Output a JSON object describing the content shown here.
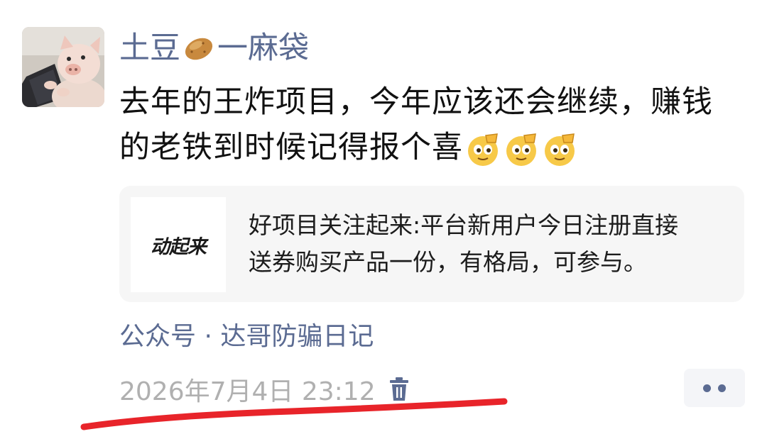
{
  "author": {
    "name_before_icon": "土豆",
    "name_icon": "potato-icon",
    "name_after_icon": "一麻袋"
  },
  "post": {
    "text_line1": "去年的王炸项目，今年应该还会继续，赚钱",
    "text_line2": "的老铁到时候记得报个喜",
    "trailing_emoji": "salute-face-emoji",
    "trailing_emoji_count": 3
  },
  "share_card": {
    "thumbnail_text": "动起来",
    "title_line1": "好项目关注起来:平台新用户今日注册直接",
    "title_line2": "送券购买产品一份，有格局，可参与。"
  },
  "source": {
    "text": "公众号 · 达哥防骗日记"
  },
  "meta": {
    "timestamp": "2026年7月4日 23:12",
    "delete_icon": "trash-icon",
    "more_icon": "more-dots-icon"
  },
  "colors": {
    "link_blue": "#5b6b92",
    "timestamp_gray": "#b0b0b0",
    "card_bg": "#f6f6f6",
    "annotation_red": "#e8242a"
  }
}
